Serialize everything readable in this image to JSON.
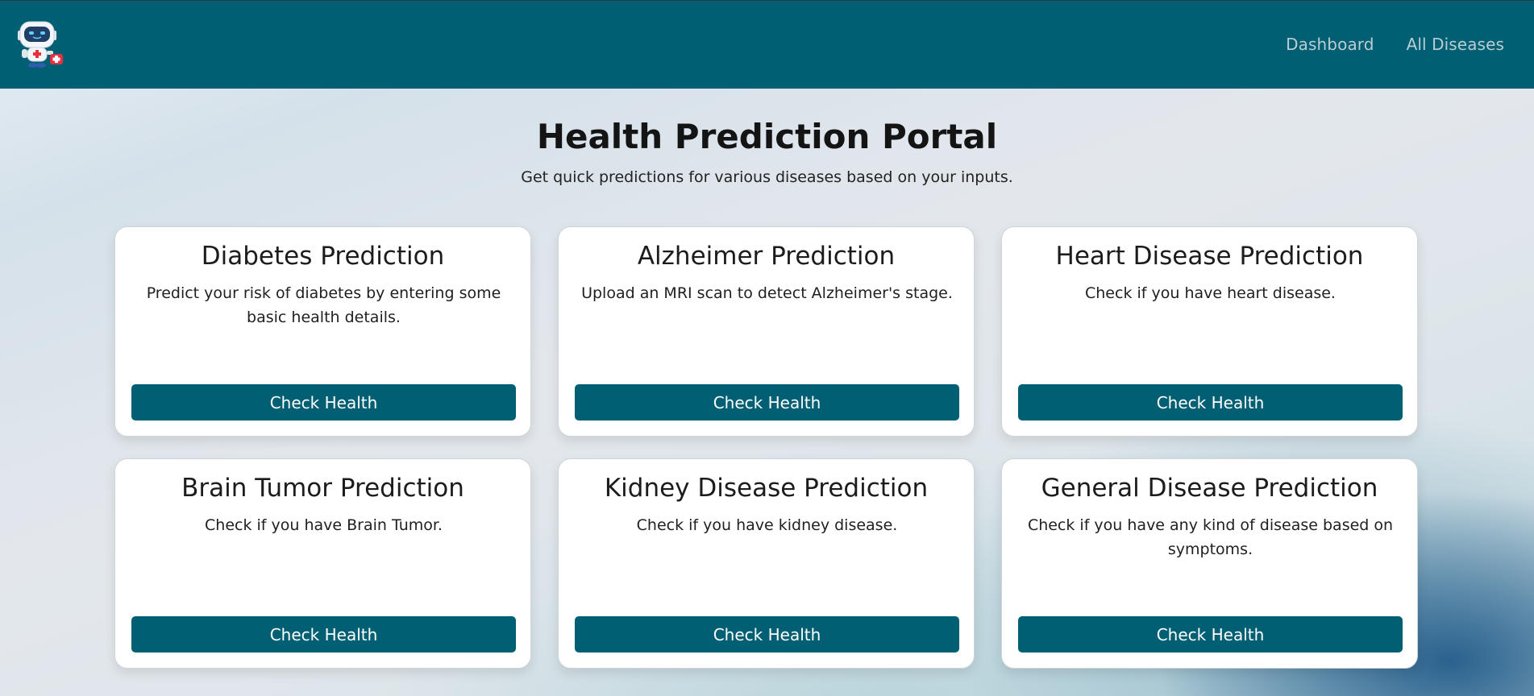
{
  "navbar": {
    "logo_icon": "robot-doctor-logo-icon",
    "links": [
      {
        "label": "Dashboard"
      },
      {
        "label": "All Diseases"
      }
    ],
    "colors": {
      "background": "#005f73",
      "link": "#b9cdd3"
    }
  },
  "main": {
    "title": "Health Prediction Portal",
    "subtitle": "Get quick predictions for various diseases based on your inputs."
  },
  "cards": [
    {
      "title": "Diabetes Prediction",
      "description": "Predict your risk of diabetes by entering some basic health details.",
      "button": "Check Health"
    },
    {
      "title": "Alzheimer Prediction",
      "description": "Upload an MRI scan to detect Alzheimer's stage.",
      "button": "Check Health"
    },
    {
      "title": "Heart Disease Prediction",
      "description": "Check if you have heart disease.",
      "button": "Check Health"
    },
    {
      "title": "Brain Tumor Prediction",
      "description": "Check if you have Brain Tumor.",
      "button": "Check Health"
    },
    {
      "title": "Kidney Disease Prediction",
      "description": "Check if you have kidney disease.",
      "button": "Check Health"
    },
    {
      "title": "General Disease Prediction",
      "description": "Check if you have any kind of disease based on symptoms.",
      "button": "Check Health"
    }
  ],
  "colors": {
    "button": "#005f73",
    "button_text": "#ffffff",
    "card_background": "#ffffff"
  }
}
